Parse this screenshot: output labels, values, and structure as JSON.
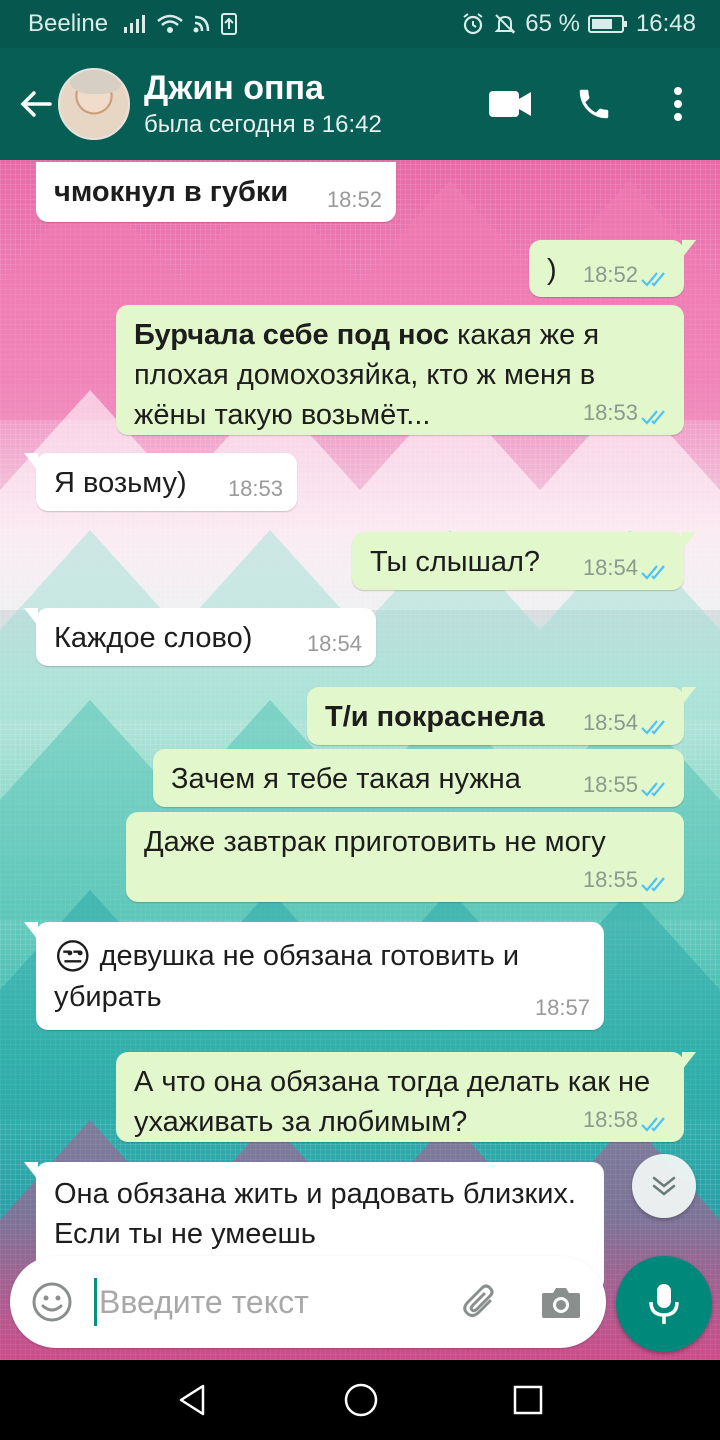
{
  "status_bar": {
    "carrier": "Beeline",
    "battery": "65 %",
    "time": "16:48",
    "icons": [
      "signal-icon",
      "wifi-icon",
      "data-icon",
      "sim-icon",
      "alarm-icon",
      "mute-icon",
      "battery-icon"
    ]
  },
  "header": {
    "contact_name": "Джин оппа",
    "last_seen": "была сегодня в 16:42",
    "icons": [
      "back-arrow-icon",
      "avatar",
      "video-call-icon",
      "phone-icon",
      "more-vert-icon"
    ]
  },
  "messages": [
    {
      "dir": "in",
      "bold": "чмокнул в губки",
      "text": "",
      "time": "18:52"
    },
    {
      "dir": "out",
      "bold": "",
      "text": ")",
      "time": "18:52"
    },
    {
      "dir": "out",
      "bold": "Бурчала себе под нос",
      "text": " какая же я плохая домохозяйка, кто ж меня в жёны такую возьмёт...",
      "time": "18:53"
    },
    {
      "dir": "in",
      "bold": "",
      "text": "Я возьму)",
      "time": "18:53"
    },
    {
      "dir": "out",
      "bold": "",
      "text": "Ты слышал?",
      "time": "18:54"
    },
    {
      "dir": "in",
      "bold": "",
      "text": "Каждое слово)",
      "time": "18:54"
    },
    {
      "dir": "out",
      "bold": "Т/и покраснела",
      "text": "",
      "time": "18:54"
    },
    {
      "dir": "out",
      "bold": "",
      "text": "Зачем я тебе такая нужна",
      "time": "18:55"
    },
    {
      "dir": "out",
      "bold": "",
      "text": "Даже завтрак приготовить не могу",
      "time": "18:55"
    },
    {
      "dir": "in",
      "bold": "",
      "emoji": "😒",
      "text": " девушка не обязана готовить и убирать",
      "time": "18:57"
    },
    {
      "dir": "out",
      "bold": "",
      "text": "А что она обязана тогда делать как не ухаживать за любимым?",
      "time": "18:58"
    },
    {
      "dir": "in",
      "bold": "",
      "text": "Она обязана жить и радовать близких. Если ты не умеешь",
      "time": ""
    }
  ],
  "input": {
    "placeholder": "Введите текст",
    "value": ""
  },
  "colors": {
    "header": "#075e54",
    "status": "#06584f",
    "out_bubble": "#e2f7cb",
    "in_bubble": "#ffffff",
    "ticks": "#4fc3f7",
    "mic": "#00897b"
  }
}
